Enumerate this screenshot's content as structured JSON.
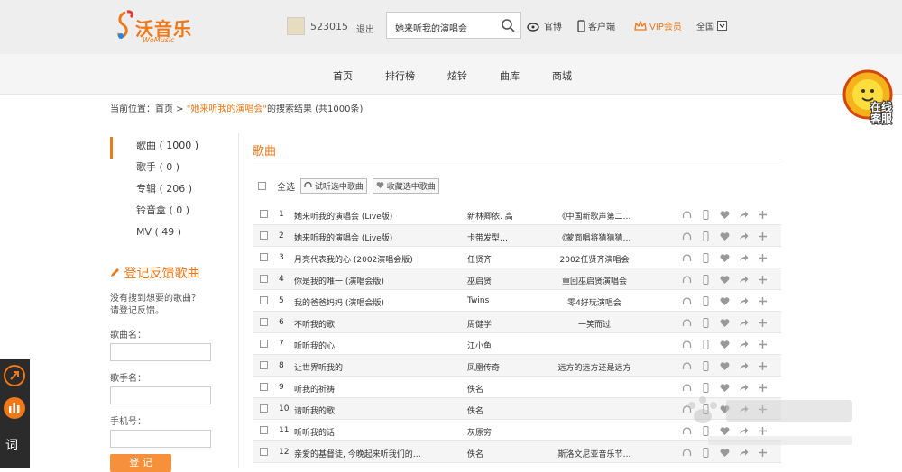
{
  "header": {
    "logo_cn": "沃音乐",
    "logo_en": "WoMusic",
    "user_id": "523015",
    "logout": "退出",
    "search": {
      "value": "她来听我的演唱会"
    },
    "weibo": "官博",
    "client": "客户端",
    "vip": "VIP会员",
    "region": "全国"
  },
  "nav": [
    "首页",
    "排行榜",
    "炫铃",
    "曲库",
    "商城"
  ],
  "customer_service": [
    "在线",
    "客服"
  ],
  "breadcrumb": {
    "prefix": "当前位置：首页 > ",
    "keyword": "\"她来听我的演唱会\"",
    "suffix": "的搜索结果 (共1000条)"
  },
  "categories": [
    {
      "label": "歌曲 ( 1000 )"
    },
    {
      "label": "歌手 ( 0 )"
    },
    {
      "label": "专辑 ( 206 )"
    },
    {
      "label": "铃音盒 ( 0 )"
    },
    {
      "label": "MV ( 49 )"
    }
  ],
  "feedback": {
    "title": "登记反馈歌曲",
    "desc1": "没有搜到想要的歌曲？",
    "desc2": "请登记反馈。",
    "song_label": "歌曲名：",
    "singer_label": "歌手名：",
    "phone_label": "手机号：",
    "submit": "登 记"
  },
  "section_title": "歌曲",
  "toolbar": {
    "select_all": "全选",
    "listen": "试听选中歌曲",
    "collect": "收藏选中歌曲"
  },
  "songs": [
    {
      "n": "1",
      "t": "她来听我的演唱会 (Live版)",
      "s": "新林卿依. 高",
      "a": "《中国新歌声第二…"
    },
    {
      "n": "2",
      "t": "她来听我的演唱会 (Live版)",
      "s": "卡带发型…",
      "a": "《蒙面唱将猜猜猜…"
    },
    {
      "n": "3",
      "t": "月亮代表我的心 (2002演唱会版)",
      "s": "任贤齐",
      "a": "2002任贤齐演唱会"
    },
    {
      "n": "4",
      "t": "你是我的唯一 (演唱会版)",
      "s": "巫启贤",
      "a": "重回巫启贤演唱会"
    },
    {
      "n": "5",
      "t": "我的爸爸妈妈 (演唱会版)",
      "s": "Twins",
      "a": "零4好玩演唱会"
    },
    {
      "n": "6",
      "t": "不听我的歌",
      "s": "周健学",
      "a": "一笑而过"
    },
    {
      "n": "7",
      "t": "听听我的心",
      "s": "江小鱼",
      "a": ""
    },
    {
      "n": "8",
      "t": "让世界听我的",
      "s": "凤凰传奇",
      "a": "远方的远方还是远方"
    },
    {
      "n": "9",
      "t": "听我的祈祷",
      "s": "佚名",
      "a": ""
    },
    {
      "n": "10",
      "t": "请听我的歌",
      "s": "佚名",
      "a": ""
    },
    {
      "n": "11",
      "t": "听听我的话",
      "s": "灰原穷",
      "a": ""
    },
    {
      "n": "12",
      "t": "亲爱的基督徒, 今晚起来听我们的…",
      "s": "佚名",
      "a": "斯洛文尼亚音乐节…"
    }
  ],
  "side_panel": {
    "lyrics": "词"
  },
  "colors": {
    "accent": "#f07818",
    "topbar": "#eeeeee"
  }
}
